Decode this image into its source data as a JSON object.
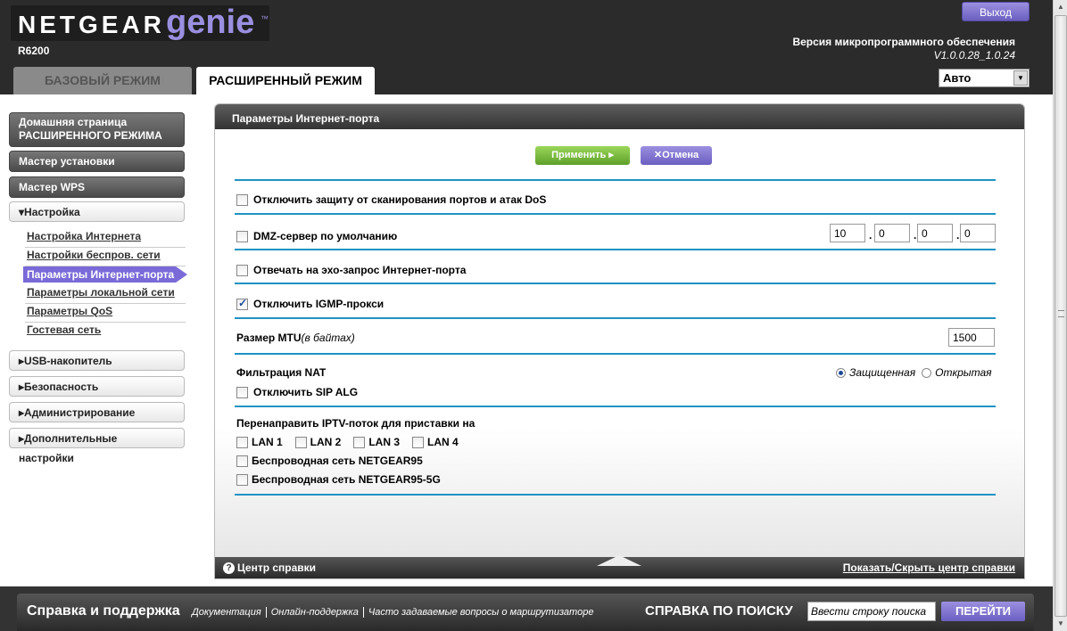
{
  "header": {
    "brand_word": "NETGEAR",
    "brand_genie": "genie",
    "trademark": "™",
    "model": "R6200",
    "logout_label": "Выход",
    "firmware_label": "Версия микропрограммного обеспечения",
    "firmware_version": "V1.0.0.28_1.0.24",
    "language_value": "Авто",
    "tabs": [
      {
        "label": "БАЗОВЫЙ РЕЖИМ",
        "active": false
      },
      {
        "label": "РАСШИРЕННЫЙ РЕЖИМ",
        "active": true
      }
    ]
  },
  "sidebar": {
    "home_line1": "Домашняя страница",
    "home_line2": "РАСШИРЕННОГО РЕЖИМА",
    "setup_wizard": "Мастер установки",
    "wps_wizard": "Мастер WPS",
    "settings": "▾Настройка",
    "sub_items": [
      "Настройка Интернета",
      "Настройки беспров. сети",
      "Параметры Интернет-порта",
      "Параметры локальной сети",
      "Параметры QoS",
      "Гостевая сеть"
    ],
    "collapsed": [
      "▸USB-накопитель",
      "▸Безопасность",
      "▸Администрирование",
      "▸Дополнительные настройки"
    ]
  },
  "panel": {
    "title": "Параметры Интернет-порта",
    "apply_label": "Применить ▸",
    "cancel_label": "✕Отмена",
    "disable_dos": "Отключить защиту от сканирования портов и атак DoS",
    "dmz_label": "DMZ-сервер по умолчанию",
    "dmz_ip": [
      "10",
      "0",
      "0",
      "0"
    ],
    "echo_label": "Отвечать на эхо-запрос Интернет-порта",
    "igmp_label": "Отключить IGMP-прокси",
    "mtu_label": "Размер MTU",
    "mtu_unit": "(в байтах)",
    "mtu_value": "1500",
    "nat_label": "Фильтрация NAT",
    "nat_secure": "Защищенная",
    "nat_open": "Открытая",
    "sip_label": "Отключить SIP ALG",
    "iptv_label": "Перенаправить IPTV-поток для приставки на",
    "lan_ports": [
      "LAN 1",
      "LAN 2",
      "LAN 3",
      "LAN 4"
    ],
    "wifi_24": "Беспроводная сеть NETGEAR95",
    "wifi_5": "Беспроводная сеть NETGEAR95-5G",
    "help_center": "Центр справки",
    "toggle_help": "Показать/Скрыть центр справки"
  },
  "footer": {
    "title": "Справка и поддержка",
    "links": [
      "Документация",
      "Онлайн-поддержка",
      "Часто задаваемые вопросы о маршрутизаторе"
    ],
    "search_label": "СПРАВКА ПО ПОИСКУ",
    "search_placeholder": "Ввести строку поиска",
    "go_label": "ПЕРЕЙТИ"
  }
}
